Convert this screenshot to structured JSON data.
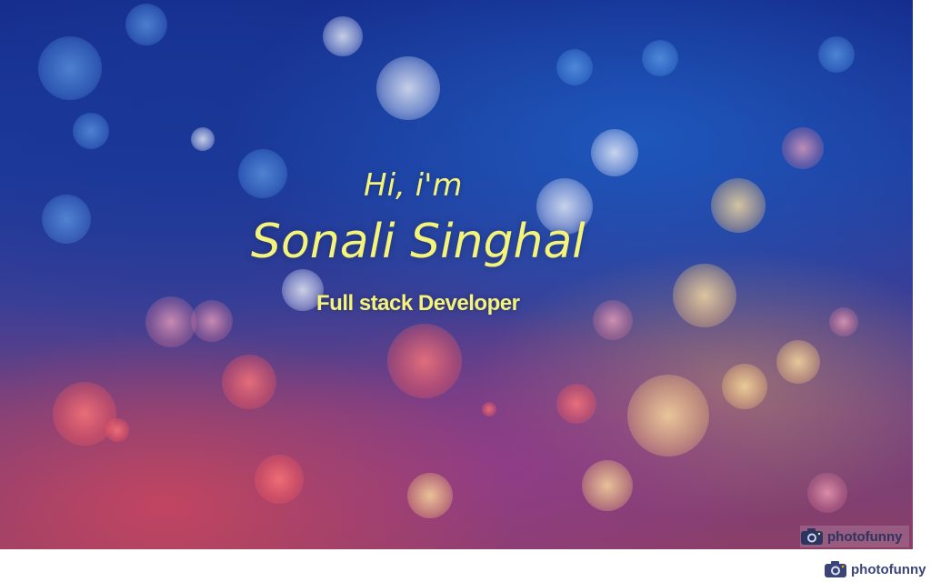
{
  "hero": {
    "greeting": "Hi, i'm",
    "name": "Sonali Singhal",
    "role": "Full stack Developer",
    "text_color": "#f4f47a",
    "background": "blue-to-pink bokeh"
  },
  "watermark": {
    "text": "photofunny",
    "icon": "camera-icon"
  }
}
